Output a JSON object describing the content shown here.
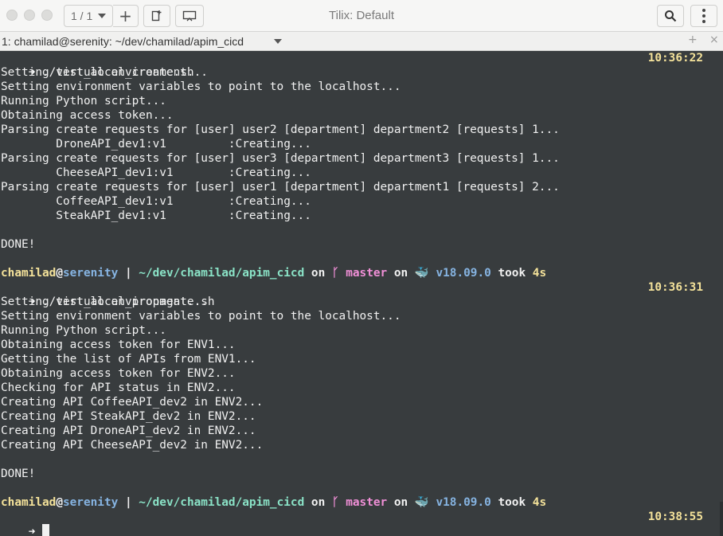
{
  "header": {
    "session_label": "1 / 1",
    "add_symbol": "+",
    "title": "Tilix: Default"
  },
  "terminal_header": {
    "title": "1: chamilad@serenity: ~/dev/chamilad/apim_cicd",
    "add_symbol": "+",
    "close_symbol": "×"
  },
  "prompt": {
    "arrow": "➜",
    "user": "chamilad",
    "at": "@",
    "host": "serenity",
    "sep": " | ",
    "path": "~/dev/chamilad/apim_cicd",
    "on": "on",
    "branch_icon": "ᚴ",
    "branch": "master",
    "docker_icon": "🐳",
    "docker_version": "v18.09.0",
    "took": "took",
    "duration": "4s"
  },
  "commands": {
    "cmd1": " ./test_local_create.sh",
    "ts1": "10:36:22",
    "cmd2": " ./test_local_propagate.sh",
    "ts2": "10:36:31",
    "ts3": "10:38:55"
  },
  "output1": [
    "Setting virtual environment...",
    "Setting environment variables to point to the localhost...",
    "Running Python script...",
    "Obtaining access token...",
    "Parsing create requests for [user] user2 [department] department2 [requests] 1...",
    "        DroneAPI_dev1:v1         :Creating...",
    "Parsing create requests for [user] user3 [department] department3 [requests] 1...",
    "        CheeseAPI_dev1:v1        :Creating...",
    "Parsing create requests for [user] user1 [department] department1 [requests] 2...",
    "        CoffeeAPI_dev1:v1        :Creating...",
    "        SteakAPI_dev1:v1         :Creating...",
    "",
    "DONE!",
    ""
  ],
  "output2": [
    "Setting virtual environment...",
    "Setting environment variables to point to the localhost...",
    "Running Python script...",
    "Obtaining access token for ENV1...",
    "Getting the list of APIs from ENV1...",
    "Obtaining access token for ENV2...",
    "Checking for API status in ENV2...",
    "Creating API CoffeeAPI_dev2 in ENV2...",
    "Creating API SteakAPI_dev2 in ENV2...",
    "Creating API DroneAPI_dev2 in ENV2...",
    "Creating API CheeseAPI_dev2 in ENV2...",
    "",
    "DONE!",
    ""
  ],
  "colors": {
    "terminal_bg": "#383c3e",
    "header_bg": "#f6f6f5",
    "timestamp": "#f4e29a",
    "host": "#86b4e2",
    "path": "#8ae2c6",
    "branch": "#f08fd7"
  }
}
